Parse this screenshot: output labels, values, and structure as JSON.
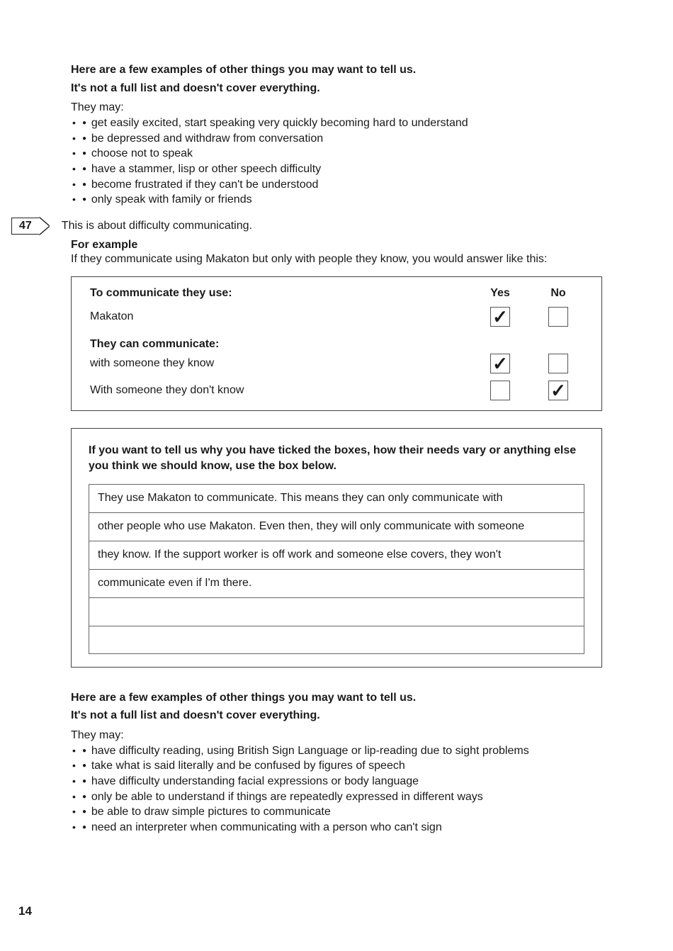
{
  "section1": {
    "heading1": "Here are a few examples of other things you may want to tell us.",
    "heading2": "It's not a full list and doesn't cover everything.",
    "intro": "They may:",
    "bullets": [
      "get easily excited, start speaking very quickly becoming hard to understand",
      "be depressed and withdraw from conversation",
      "choose not to speak",
      "have a stammer, lisp or other speech difficulty",
      "become frustrated if they can't be understood",
      "only speak with family or friends"
    ]
  },
  "marker": {
    "number": "47",
    "text": "This is about difficulty communicating."
  },
  "example": {
    "heading": "For example",
    "intro": "If they communicate using Makaton but only with people they know, you would answer like this:",
    "table": {
      "label1": "To communicate they use:",
      "yes": "Yes",
      "no": "No",
      "row1": "Makaton",
      "row1_yes": "✓",
      "row1_no": "",
      "label2": "They can communicate:",
      "row2": "with someone they know",
      "row2_yes": "✓",
      "row2_no": "",
      "row3": "With someone they don't know",
      "row3_yes": "",
      "row3_no": "✓"
    }
  },
  "notes": {
    "heading": "If you want to tell us why you have ticked the boxes, how their needs vary or anything else you think we should know, use the box below.",
    "lines": [
      "They use Makaton to communicate. This means they can only communicate with",
      "other people who use Makaton. Even then, they will only communicate with someone",
      "they know. If the support worker is off work and someone else covers, they won't",
      "communicate even if I'm there.",
      "",
      ""
    ]
  },
  "section2": {
    "heading1": "Here are a few examples of other things you may want to tell us.",
    "heading2": "It's not a full list and doesn't cover everything.",
    "intro": "They may:",
    "bullets": [
      "have difficulty reading, using British Sign Language or lip-reading due to sight problems",
      "take what is said literally and be confused by figures of speech",
      "have difficulty understanding facial expressions or body language",
      "only be able to understand if things are repeatedly expressed in different ways",
      "be able to draw simple pictures to communicate",
      "need an interpreter when communicating with a person who can't sign"
    ]
  },
  "page_number": "14"
}
